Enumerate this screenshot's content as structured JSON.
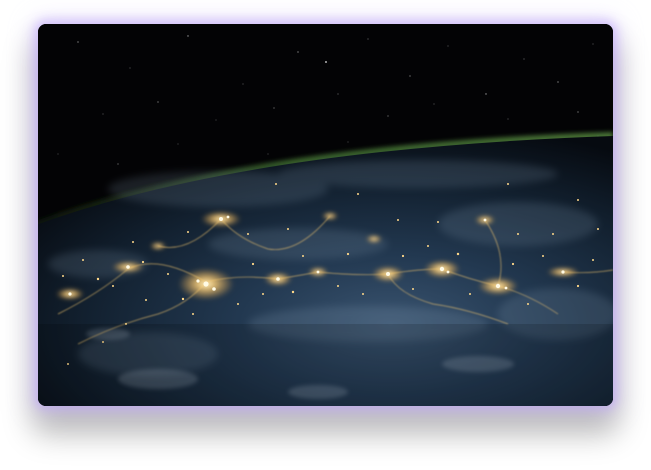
{
  "image": {
    "subject": "earth-at-night-from-orbit",
    "colors": {
      "space": "#030305",
      "ocean_dark": "#0b1622",
      "ocean_light": "#2a3f56",
      "atmosphere": "#3c6a34",
      "city_lights": "#ffc766",
      "card_glow": "#b9a2ff"
    }
  }
}
